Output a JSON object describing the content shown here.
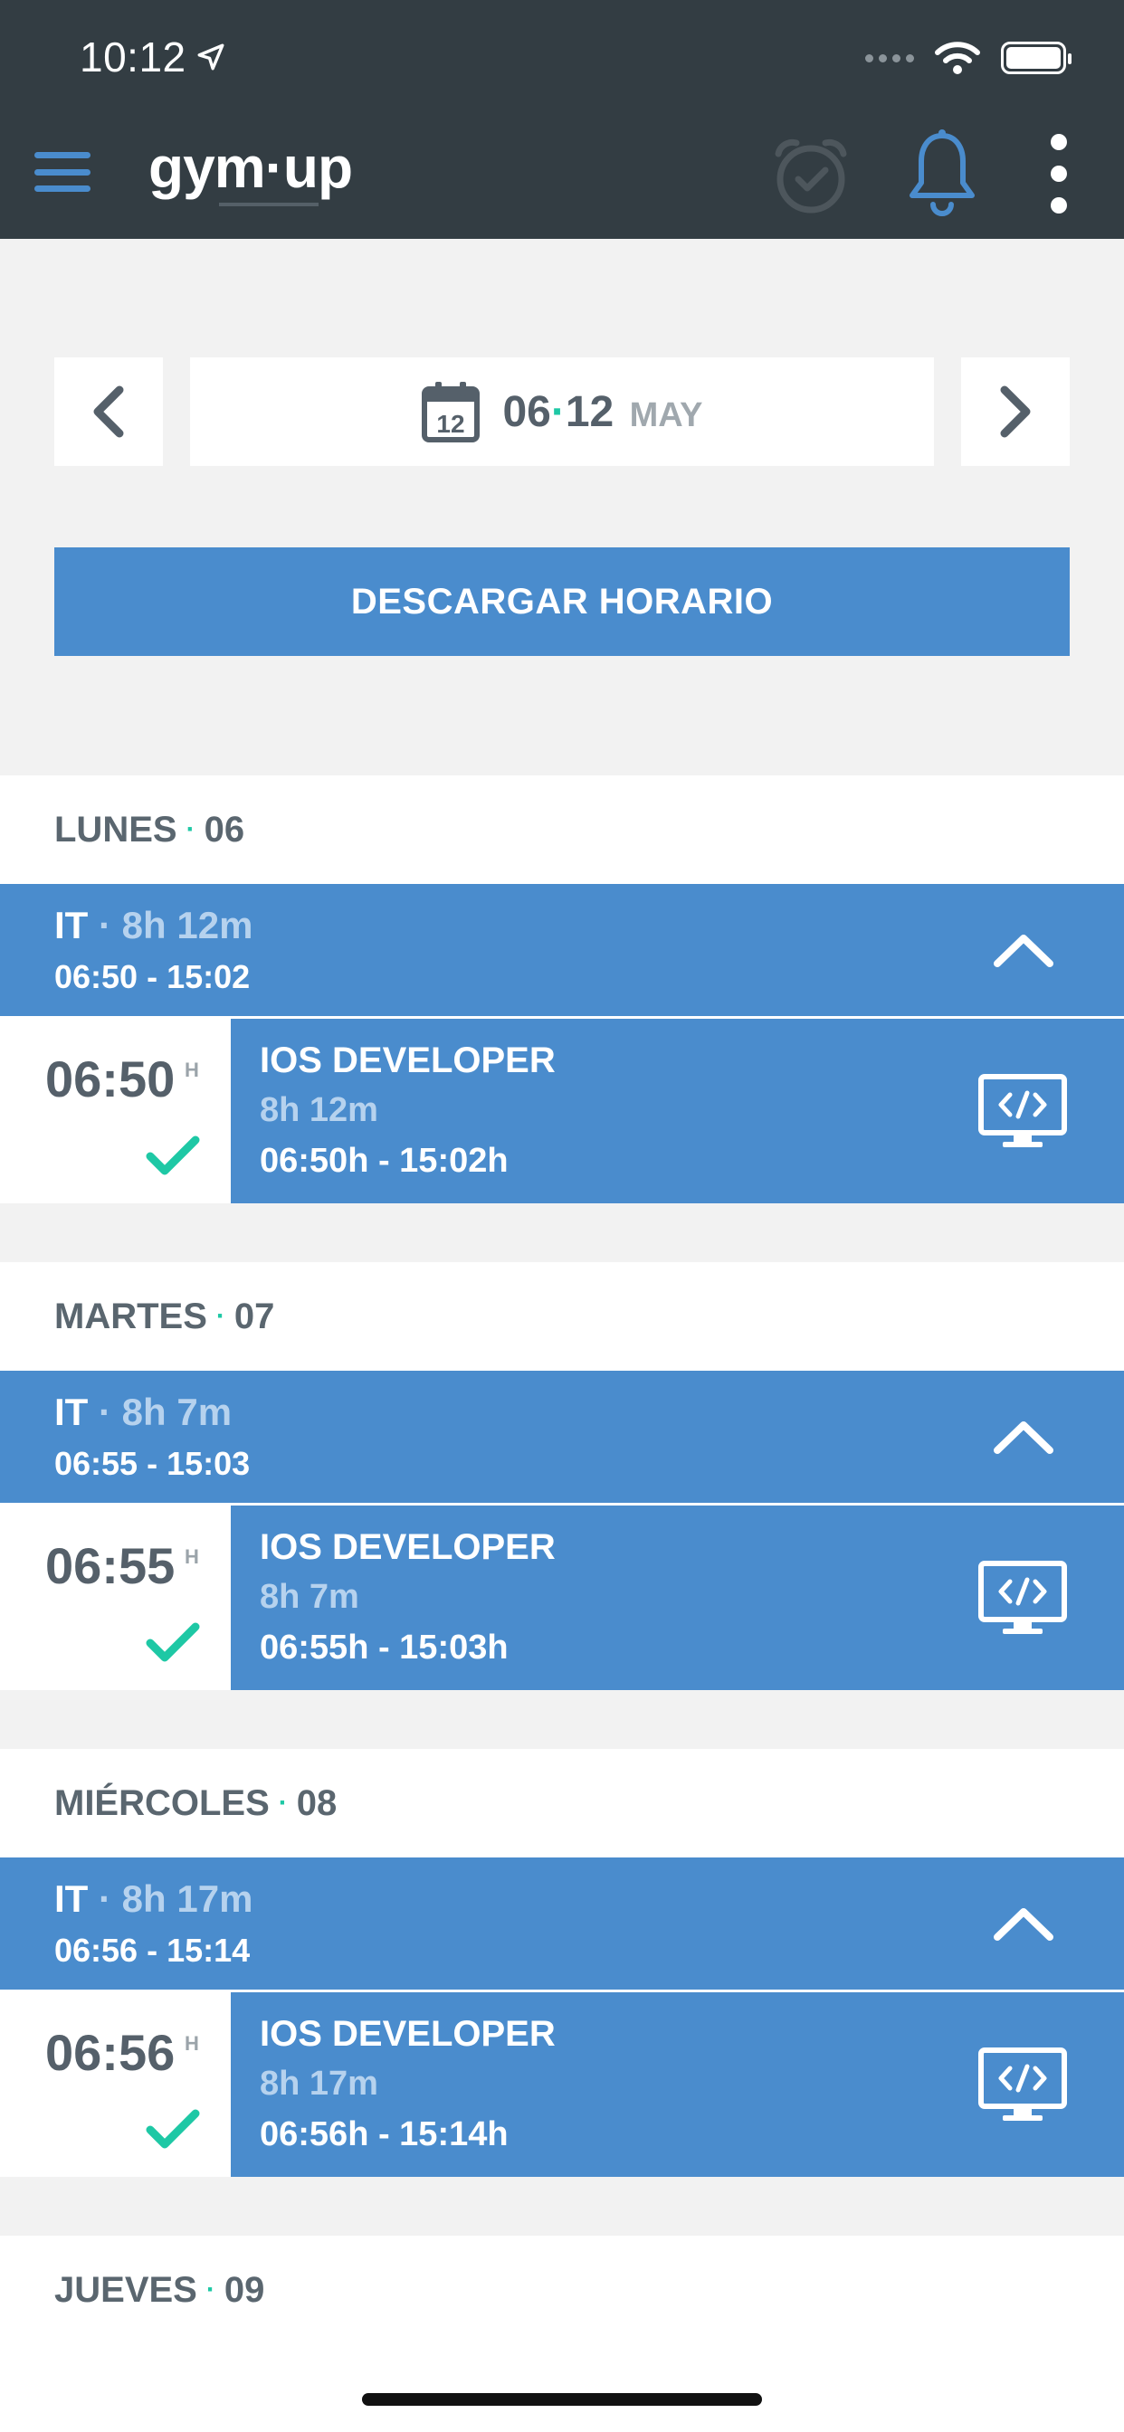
{
  "status_bar": {
    "time": "10:12",
    "location_icon": "location-arrow-icon",
    "wifi_icon": "wifi-icon",
    "battery_icon": "battery-icon"
  },
  "header": {
    "logo_text": "gym·up",
    "menu_icon": "hamburger-menu-icon",
    "alarm_icon": "alarm-clock-check-icon",
    "bell_icon": "bell-icon",
    "more_icon": "vertical-dots-icon"
  },
  "date_picker": {
    "calendar_icon_day": "12",
    "range_start": "06",
    "range_separator": "·",
    "range_end": "12",
    "month": "MAY"
  },
  "download_button": {
    "label": "DESCARGAR HORARIO"
  },
  "days": [
    {
      "name": "LUNES",
      "separator": "·",
      "number": "06",
      "group": {
        "title": "IT",
        "separator": "·",
        "duration": "8h 12m",
        "range": "06:50 - 15:02"
      },
      "shift": {
        "start": "06:50",
        "unit": "H",
        "role": "IOS DEVELOPER",
        "duration": "8h 12m",
        "span": "06:50h - 15:02h"
      }
    },
    {
      "name": "MARTES",
      "separator": "·",
      "number": "07",
      "group": {
        "title": "IT",
        "separator": "·",
        "duration": "8h 7m",
        "range": "06:55 - 15:03"
      },
      "shift": {
        "start": "06:55",
        "unit": "H",
        "role": "IOS DEVELOPER",
        "duration": "8h 7m",
        "span": "06:55h - 15:03h"
      }
    },
    {
      "name": "MIÉRCOLES",
      "separator": "·",
      "number": "08",
      "group": {
        "title": "IT",
        "separator": "·",
        "duration": "8h 17m",
        "range": "06:56 - 15:14"
      },
      "shift": {
        "start": "06:56",
        "unit": "H",
        "role": "IOS DEVELOPER",
        "duration": "8h 17m",
        "span": "06:56h - 15:14h"
      }
    },
    {
      "name": "JUEVES",
      "separator": "·",
      "number": "09"
    }
  ],
  "colors": {
    "header_bg": "#333d43",
    "accent_blue": "#4a8ccd",
    "accent_green": "#1ec8a5",
    "page_bg": "#f2f2f2"
  }
}
